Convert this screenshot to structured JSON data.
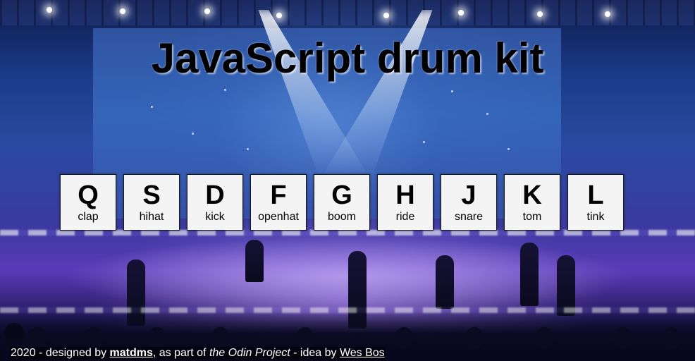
{
  "header": {
    "title": "JavaScript drum kit"
  },
  "keys": [
    {
      "letter": "Q",
      "sound": "clap"
    },
    {
      "letter": "S",
      "sound": "hihat"
    },
    {
      "letter": "D",
      "sound": "kick"
    },
    {
      "letter": "F",
      "sound": "openhat"
    },
    {
      "letter": "G",
      "sound": "boom"
    },
    {
      "letter": "H",
      "sound": "ride"
    },
    {
      "letter": "J",
      "sound": "snare"
    },
    {
      "letter": "K",
      "sound": "tom"
    },
    {
      "letter": "L",
      "sound": "tink"
    }
  ],
  "footer": {
    "prefix": "2020 - designed by ",
    "author_link": "matdms",
    "middle": ", as part of ",
    "project": "the Odin Project",
    "idea": " - idea by ",
    "idea_link": "Wes Bos"
  },
  "colors": {
    "key_background": "#f4f4f4",
    "key_border": "#1a1a1a",
    "title_text": "#000000",
    "footer_text": "#ffffff"
  }
}
